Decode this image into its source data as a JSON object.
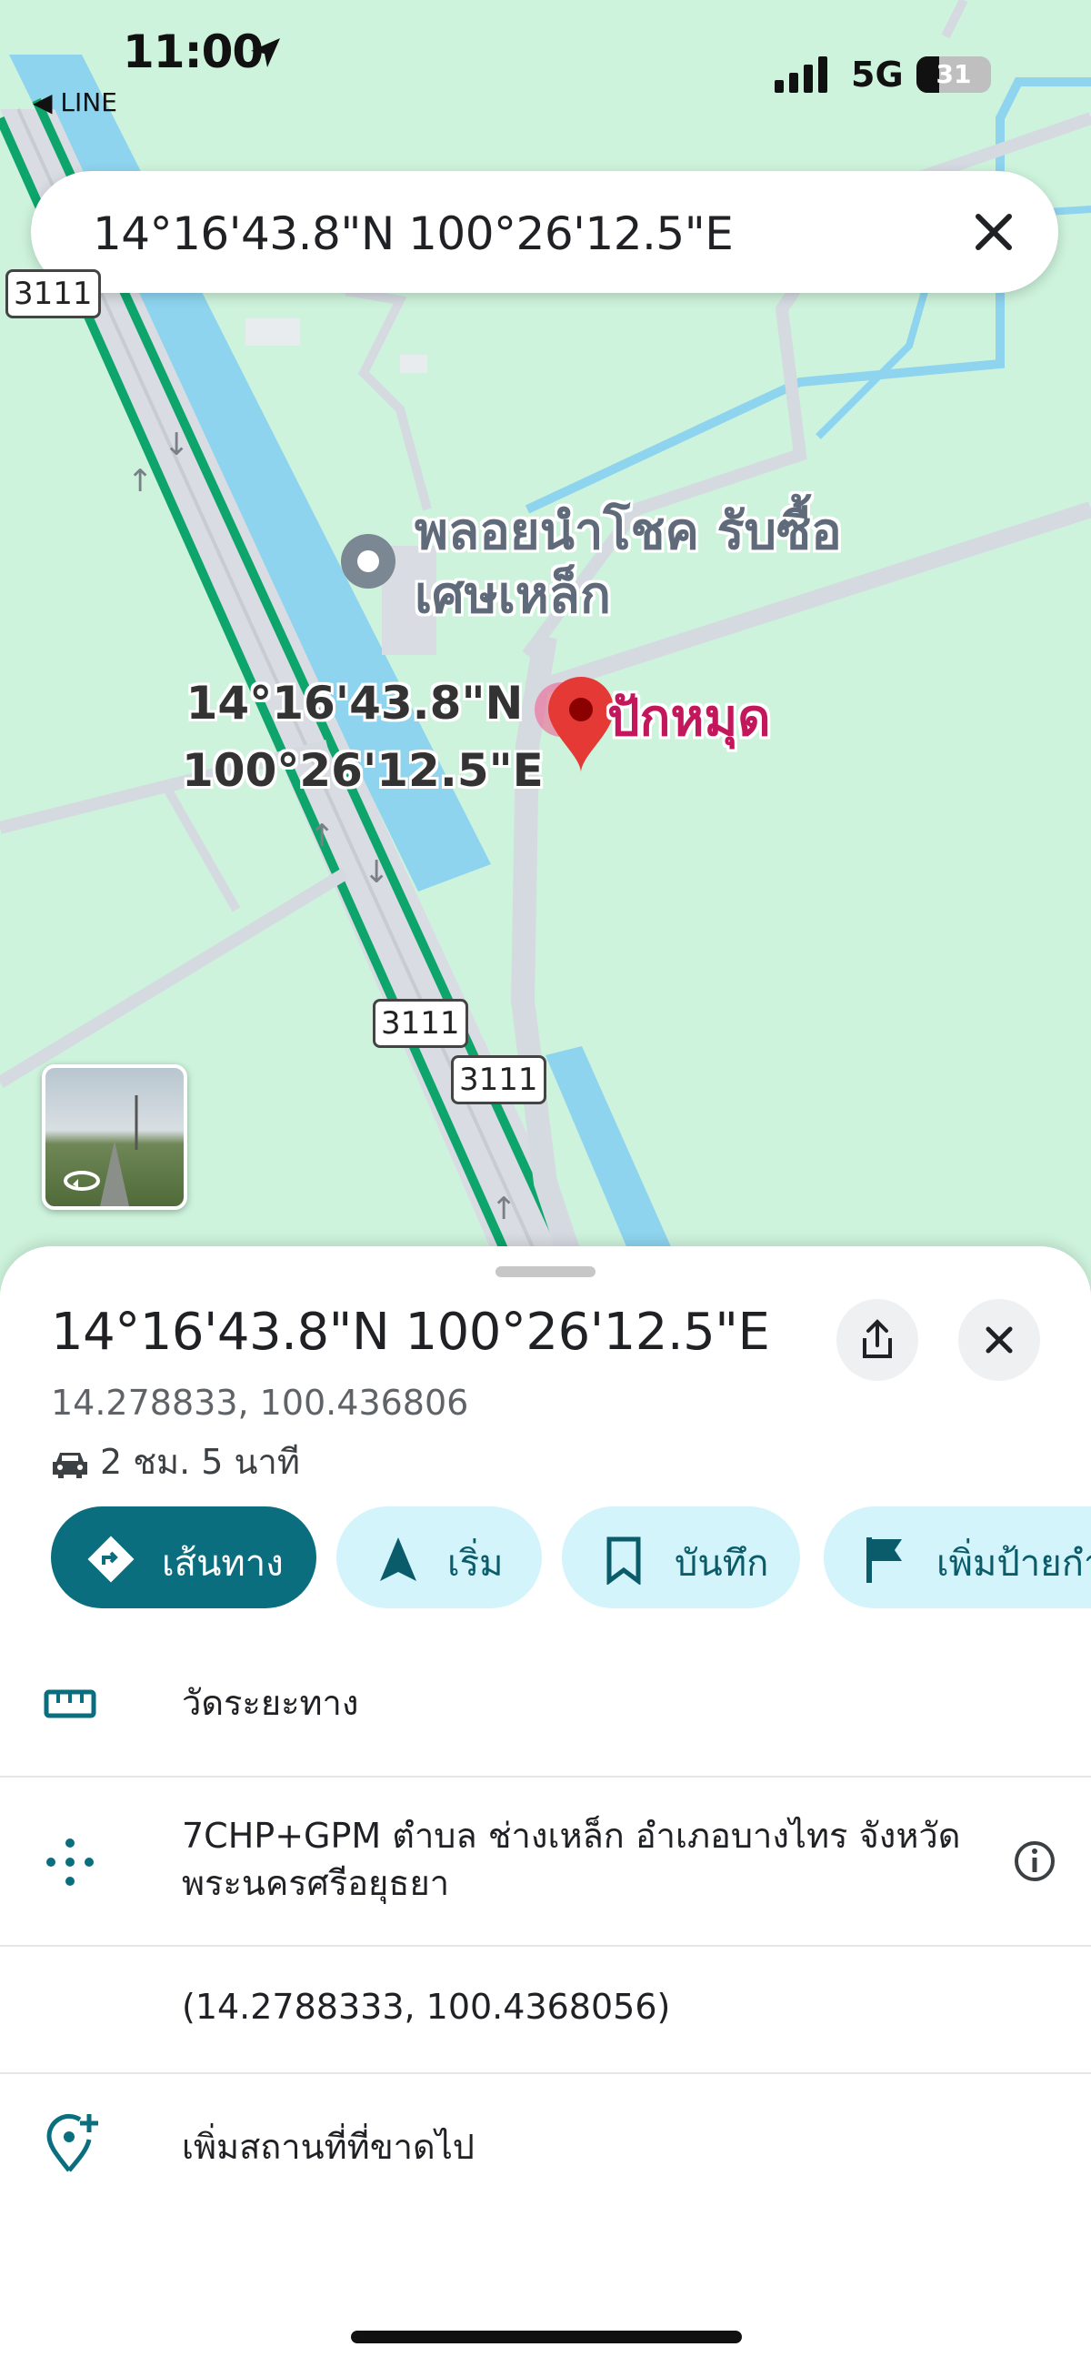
{
  "status_bar": {
    "time": "11:00",
    "back_app": "◀ LINE",
    "network": "5G",
    "battery": "31",
    "battery_level_percent": 31
  },
  "search": {
    "query": "14°16'43.8\"N 100°26'12.5\"E"
  },
  "map": {
    "poi_label": "พลอยนำโชค รับซื้อเศษเหล็ก",
    "coord_label_line1": "14°16'43.8\"N",
    "coord_label_line2": "100°26'12.5\"E",
    "pin_label": "ปักหมุด",
    "road_shields": [
      "3111",
      "3111",
      "3111"
    ]
  },
  "place": {
    "title": "14°16'43.8\"N 100°26'12.5\"E",
    "decimal": "14.278833, 100.436806",
    "drive_time": "2 ชม. 5 นาที"
  },
  "actions": [
    {
      "label": "เส้นทาง",
      "icon": "directions-icon"
    },
    {
      "label": "เริ่ม",
      "icon": "navigation-arrow-icon"
    },
    {
      "label": "บันทึก",
      "icon": "bookmark-icon"
    },
    {
      "label": "เพิ่มป้ายกำ",
      "icon": "flag-icon"
    }
  ],
  "details": {
    "measure": "วัดระยะทาง",
    "plus_code": "7CHP+GPM ตำบล ช่างเหล็ก อำเภอบางไทร จังหวัดพระนครศรีอยุธยา",
    "coordinates": "(14.2788333, 100.4368056)",
    "add_place": "เพิ่มสถานที่ที่ขาดไป"
  },
  "colors": {
    "map_bg": "#cdf3dc",
    "water": "#8ed4ef",
    "highway": "#0da56b",
    "accent": "#0b6e7e",
    "chip_bg": "#d3f4fb",
    "pin": "#e53935"
  }
}
